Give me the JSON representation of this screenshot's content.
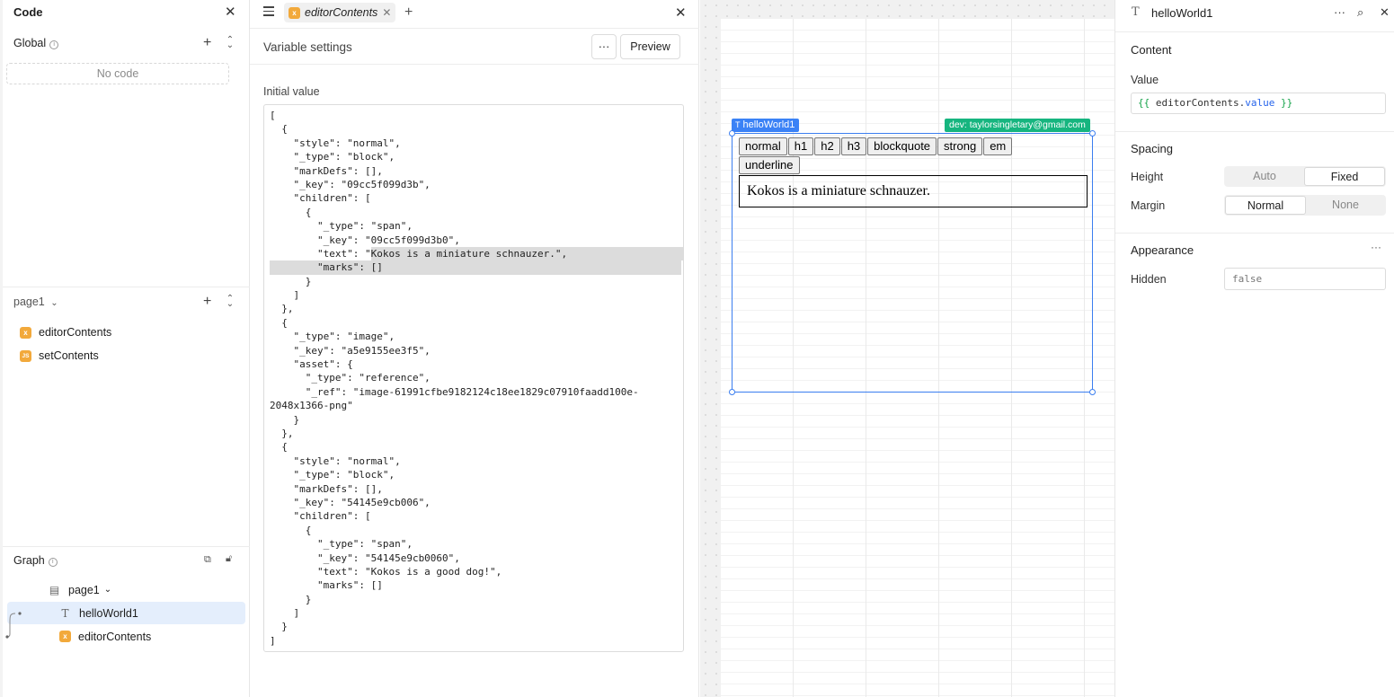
{
  "left_panel": {
    "title": "Code",
    "global": {
      "label": "Global",
      "empty_text": "No code"
    },
    "page": {
      "label": "page1",
      "items": [
        {
          "badge": "x",
          "label": "editorContents"
        },
        {
          "badge": "JS",
          "label": "setContents"
        }
      ]
    },
    "graph": {
      "label": "Graph",
      "rows": [
        {
          "label": "page1"
        },
        {
          "label": "helloWorld1"
        },
        {
          "label": "editorContents"
        }
      ]
    }
  },
  "middle_panel": {
    "tab_label": "editorContents",
    "header_title": "Variable settings",
    "more_label": "···",
    "preview_label": "Preview",
    "initial_value_label": "Initial value",
    "code_lines": [
      "[",
      "  {",
      "    \"style\": \"normal\",",
      "    \"_type\": \"block\",",
      "    \"markDefs\": [],",
      "    \"_key\": \"09cc5f099d3b\",",
      "    \"children\": [",
      "      {",
      "        \"_type\": \"span\",",
      "        \"_key\": \"09cc5f099d3b0\",",
      "        \"text\": \"Kokos is a miniature schnauzer.\",",
      "        \"marks\": []",
      "      }",
      "    ]",
      "  },",
      "  {",
      "    \"_type\": \"image\",",
      "    \"_key\": \"a5e9155ee3f5\",",
      "    \"asset\": {",
      "      \"_type\": \"reference\",",
      "      \"_ref\": \"image-61991cfbe9182124c18ee1829c07910faadd100e-",
      "2048x1366-png\"",
      "    }",
      "  },",
      "  {",
      "    \"style\": \"normal\",",
      "    \"_type\": \"block\",",
      "    \"markDefs\": [],",
      "    \"_key\": \"54145e9cb006\",",
      "    \"children\": [",
      "      {",
      "        \"_type\": \"span\",",
      "        \"_key\": \"54145e9cb0060\",",
      "        \"text\": \"Kokos is a good dog!\",",
      "        \"marks\": []",
      "      }",
      "    ]",
      "  }",
      "]"
    ]
  },
  "canvas": {
    "component_tag": "helloWorld1",
    "dev_tag": "dev: taylorsingletary@gmail.com",
    "toolbar_buttons": [
      "normal",
      "h1",
      "h2",
      "h3",
      "blockquote",
      "strong",
      "em",
      "underline"
    ],
    "content_text": "Kokos is a miniature schnauzer."
  },
  "inspector": {
    "component_name": "helloWorld1",
    "content_title": "Content",
    "value_label": "Value",
    "value_expr": {
      "open": "{{ ",
      "obj": "editorContents",
      "dot": ".",
      "prop": "value",
      "close": " }}"
    },
    "spacing_title": "Spacing",
    "height_label": "Height",
    "height_options": [
      "Auto",
      "Fixed"
    ],
    "height_selected": "Fixed",
    "margin_label": "Margin",
    "margin_options": [
      "Normal",
      "None"
    ],
    "margin_selected": "Normal",
    "appearance_title": "Appearance",
    "appearance_more": "···",
    "hidden_label": "Hidden",
    "hidden_value": "false"
  },
  "colors": {
    "accent": "#3b82f6",
    "dev_badge": "#16b57f",
    "variable_badge": "#f2a93b",
    "selected_row": "#e4eefc"
  }
}
